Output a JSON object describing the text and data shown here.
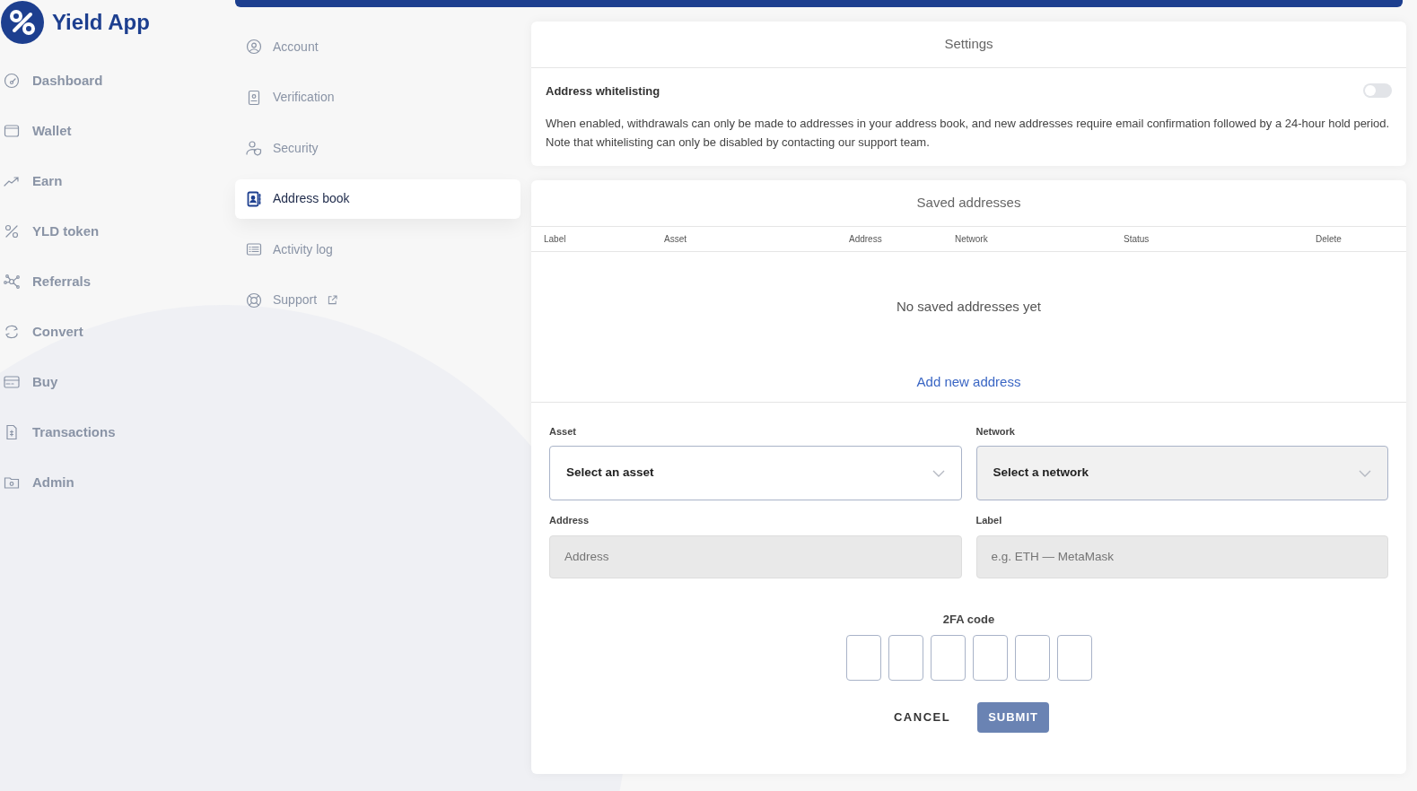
{
  "brand": {
    "name": "Yield App"
  },
  "sidebar": {
    "items": [
      {
        "label": "Dashboard",
        "selected": false
      },
      {
        "label": "Wallet",
        "selected": false
      },
      {
        "label": "Earn",
        "selected": false
      },
      {
        "label": "YLD token",
        "selected": false
      },
      {
        "label": "Referrals",
        "selected": false
      },
      {
        "label": "Convert",
        "selected": false
      },
      {
        "label": "Buy",
        "selected": false
      },
      {
        "label": "Transactions",
        "selected": false
      },
      {
        "label": "Admin",
        "selected": false
      }
    ]
  },
  "settings_nav": {
    "items": [
      {
        "label": "Account",
        "selected": false,
        "external": false
      },
      {
        "label": "Verification",
        "selected": false,
        "external": false
      },
      {
        "label": "Security",
        "selected": false,
        "external": false
      },
      {
        "label": "Address book",
        "selected": true,
        "external": false
      },
      {
        "label": "Activity log",
        "selected": false,
        "external": false
      },
      {
        "label": "Support",
        "selected": false,
        "external": true
      }
    ]
  },
  "settings": {
    "title": "Settings",
    "whitelisting": {
      "label": "Address whitelisting",
      "on": false,
      "description": "When enabled, withdrawals can only be made to addresses in your address book, and new addresses require email confirmation followed by a 24-hour hold period. Note that whitelisting can only be disabled by contacting our support team."
    }
  },
  "saved_addresses": {
    "title": "Saved addresses",
    "columns": [
      "Label",
      "Asset",
      "Address",
      "Network",
      "Status",
      "Delete"
    ],
    "empty_message": "No saved addresses yet"
  },
  "add_form": {
    "title": "Add new address",
    "fields": [
      {
        "kind": "select",
        "label": "Asset",
        "value": "Select an asset",
        "disabled": false
      },
      {
        "kind": "select",
        "label": "Network",
        "value": "Select a network",
        "disabled": true
      },
      {
        "kind": "text",
        "label": "Address",
        "placeholder": "Address",
        "disabled": true
      },
      {
        "kind": "text",
        "label": "Label",
        "placeholder": "e.g. ETH — MetaMask",
        "disabled": true
      }
    ],
    "code_label": "2FA code",
    "code_boxes": [
      {
        "filled": false
      },
      {
        "filled": false
      },
      {
        "filled": false
      },
      {
        "filled": false
      },
      {
        "filled": false
      },
      {
        "filled": false
      }
    ],
    "cancel": "CANCEL",
    "submit": {
      "label": "SUBMIT",
      "disabled": true
    }
  }
}
